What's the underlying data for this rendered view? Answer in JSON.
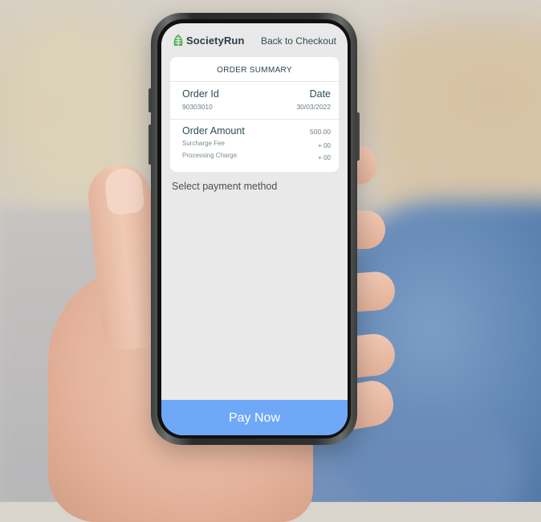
{
  "app": {
    "brand_name": "SocietyRun",
    "brand_color": "#4caf50",
    "back_link": "Back to Checkout"
  },
  "order_summary": {
    "title": "ORDER SUMMARY",
    "order_id_label": "Order Id",
    "order_id_value": "90303010",
    "date_label": "Date",
    "date_value": "30/03/2022",
    "amount_label": "Order Amount",
    "amount_value": "500.00",
    "surcharge_label": "Surcharge Fee",
    "surcharge_value": "+ 00",
    "processing_label": "Processing Charge",
    "processing_value": "+ 00"
  },
  "payment": {
    "prompt": "Select payment method",
    "pay_button": "Pay Now",
    "pay_button_color": "#6ea8f7"
  },
  "icons": {
    "logo": "leaf-building-icon"
  }
}
